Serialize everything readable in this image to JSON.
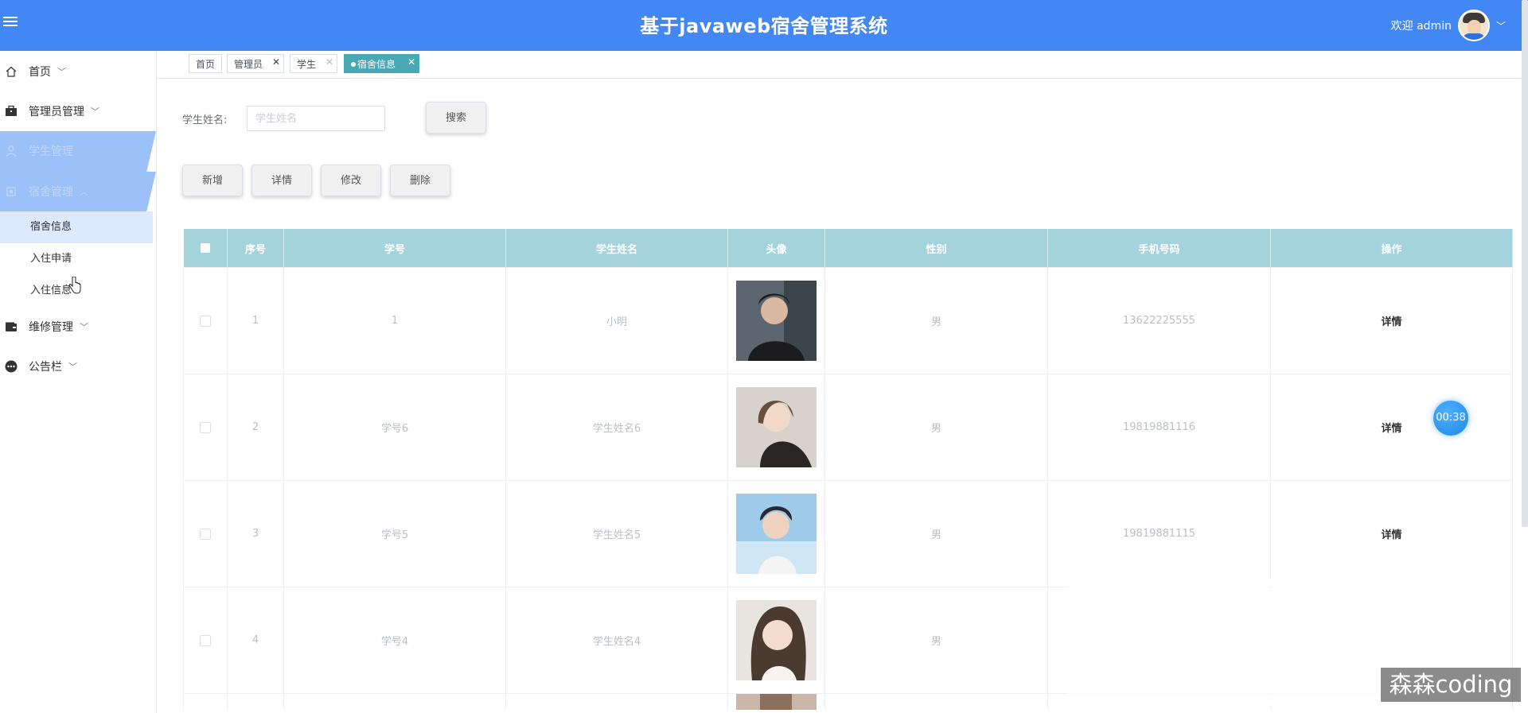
{
  "header": {
    "title": "基于javaweb宿舍管理系统",
    "greeting": "欢迎 admin",
    "caret": "﹀"
  },
  "sidebar": {
    "items": [
      {
        "label": "首页",
        "icon": "home-icon",
        "chevron": "﹀"
      },
      {
        "label": "管理员管理",
        "icon": "briefcase-icon",
        "chevron": "﹀"
      },
      {
        "label": "学生管理",
        "icon": "user-icon",
        "chevron": ""
      },
      {
        "label": "宿舍管理",
        "icon": "chip-icon",
        "chevron": "︿"
      },
      {
        "label": "维修管理",
        "icon": "wallet-icon",
        "chevron": "﹀"
      },
      {
        "label": "公告栏",
        "icon": "more-icon",
        "chevron": "﹀"
      }
    ],
    "submenu": [
      {
        "label": "宿舍信息",
        "active": true
      },
      {
        "label": "入住申请",
        "active": false
      },
      {
        "label": "入住信息",
        "active": false
      }
    ]
  },
  "tabs": [
    {
      "label": "首页",
      "closable": false
    },
    {
      "label": "管理员",
      "closable": true
    },
    {
      "label": "学生",
      "closable": true
    },
    {
      "label": "宿舍信息",
      "closable": true,
      "active": true
    }
  ],
  "tab_close": "✕",
  "search": {
    "label": "学生姓名:",
    "placeholder": "学生姓名",
    "value": "",
    "button": "搜索"
  },
  "actions": {
    "add": "新增",
    "detail": "详情",
    "edit": "修改",
    "delete": "删除"
  },
  "table": {
    "headers": [
      "序号",
      "学号",
      "学生姓名",
      "头像",
      "性别",
      "手机号码",
      "操作"
    ],
    "rows": [
      {
        "index": "1",
        "student_no": "1",
        "name": "小明",
        "avatar": "photo-1",
        "gender": "男",
        "phone": "13622225555",
        "op": "详情"
      },
      {
        "index": "2",
        "student_no": "学号6",
        "name": "学生姓名6",
        "avatar": "photo-2",
        "gender": "男",
        "phone": "19819881116",
        "op": "详情"
      },
      {
        "index": "3",
        "student_no": "学号5",
        "name": "学生姓名5",
        "avatar": "photo-3",
        "gender": "男",
        "phone": "19819881115",
        "op": "详情"
      },
      {
        "index": "4",
        "student_no": "学号4",
        "name": "学生姓名4",
        "avatar": "photo-4",
        "gender": "男",
        "phone": "",
        "op": ""
      }
    ]
  },
  "overlay": {
    "timer": "00:38",
    "watermark": "森森coding"
  },
  "colors": {
    "header_bg": "#4387f5",
    "table_header_bg": "#a4d3dc",
    "active_tab": "#48a8b4",
    "menu_highlight": "#9cc1f8"
  }
}
